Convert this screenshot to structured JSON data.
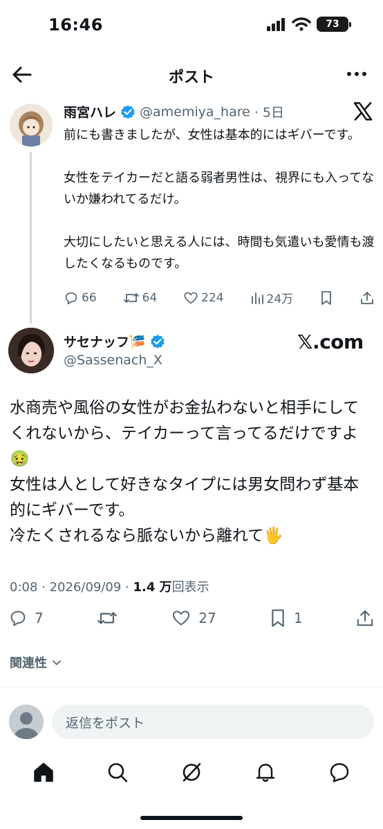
{
  "status_bar": {
    "time": "16:46",
    "battery": "73",
    "icons": [
      "cellular-signal-icon",
      "wifi-icon",
      "battery-icon"
    ]
  },
  "header": {
    "title": "ポスト",
    "back_icon": "arrow-left-icon",
    "more_icon": "more-horizontal-icon"
  },
  "quoted_tweet": {
    "display_name": "雨宮ハレ",
    "handle": "@amemiya_hare",
    "time": "· 5日",
    "body": "前にも書きましたが、女性は基本的にはギバーです。\n\n女性をテイカーだと語る弱者男性は、視界にも入ってないか嫌われてるだけ。\n\n大切にしたいと思える人には、時間も気遣いも愛情も渡したくなるものです。",
    "replies": "66",
    "retweets": "64",
    "likes": "224",
    "views": "24万",
    "source_icon": "x-logo-icon"
  },
  "main_tweet": {
    "display_name": "サセナッフ🎏",
    "handle": "@Sassenach_X",
    "source_label": "𝕏.com",
    "body_lines": [
      "水商売や風俗の女性がお金払わないと相手にして",
      "くれないから、テイカーって言ってるだけですよ",
      "🤢",
      "女性は人として好きなタイプには男女問わず基本",
      "的にギバーです。",
      "冷たくされるなら脈ないから離れて🖐"
    ],
    "timestamp": "0:08 · 2026/09/09 · ",
    "view_count": "1.4 万",
    "view_label": "回表示",
    "replies": "7",
    "likes": "27",
    "bookmarks": "1"
  },
  "sort": {
    "label": "関連性"
  },
  "reply_bar": {
    "placeholder": "返信をポスト"
  },
  "tabbar": {
    "items": [
      "home-icon",
      "search-icon",
      "grok-icon",
      "notifications-icon",
      "messages-icon"
    ]
  },
  "colors": {
    "text": "#0f1419",
    "secondary": "#536471",
    "verified": "#1d9bf0",
    "divider": "#eff3f4"
  }
}
